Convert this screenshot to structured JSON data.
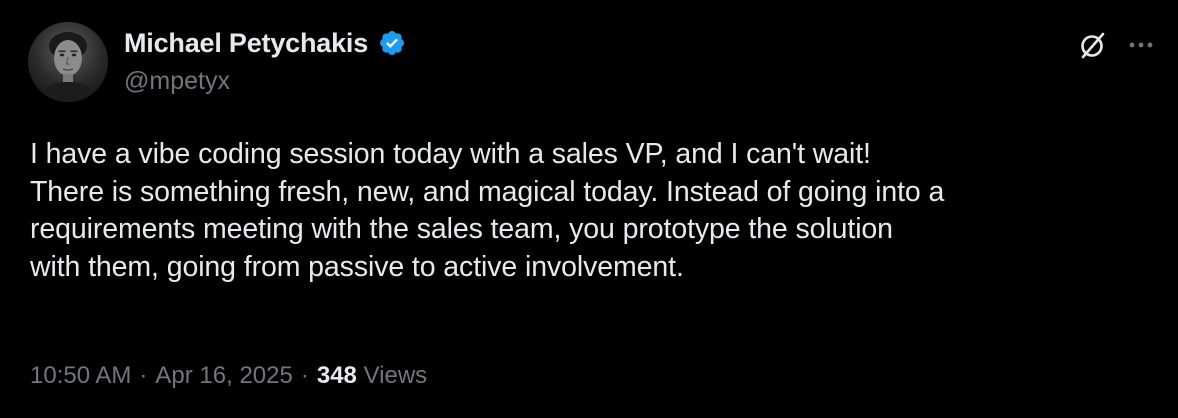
{
  "author": {
    "display_name": "Michael Petychakis",
    "handle": "@mpetyx",
    "verified": true,
    "avatar_icon": "avatar-photo"
  },
  "tweet": {
    "text": "I have a vibe coding session today with a sales VP, and I can't wait!\nThere is something fresh, new, and magical today. Instead of going into a\nrequirements meeting with the sales team, you prototype the solution\nwith them, going from passive to active involvement."
  },
  "meta": {
    "time": "10:50 AM",
    "separator": "·",
    "date": "Apr 16, 2025",
    "views_count": "348",
    "views_label": "Views"
  },
  "icons": {
    "verified": "verified-badge-icon",
    "grok": "grok-icon",
    "more": "more-options-icon"
  },
  "colors": {
    "background": "#000000",
    "primary_text": "#e7e9ea",
    "secondary_text": "#71767b",
    "verified_blue": "#1d9bf0"
  }
}
